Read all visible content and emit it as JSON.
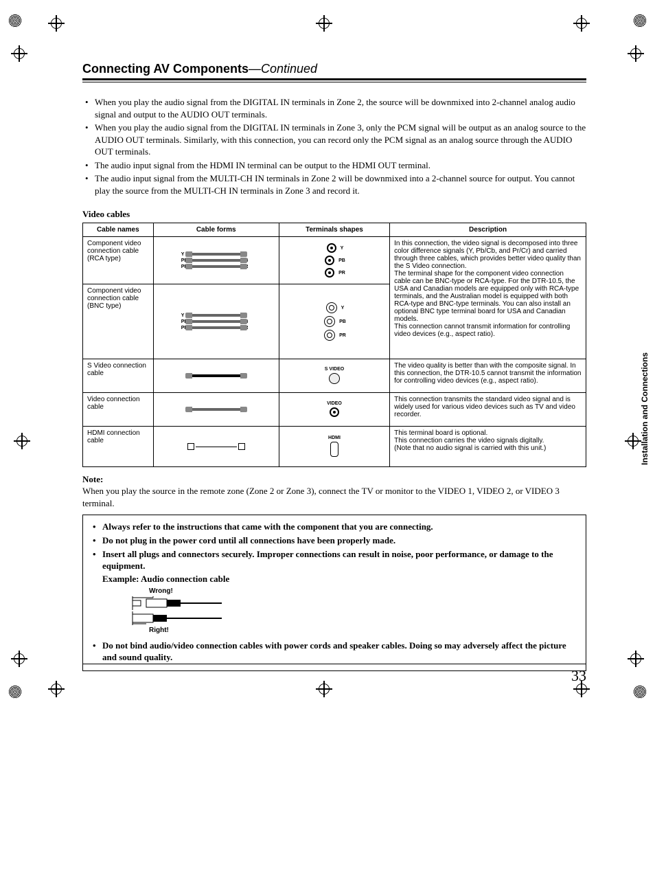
{
  "sideTab": "Installation and Connections",
  "pageNumber": "33",
  "heading": {
    "title": "Connecting AV Components",
    "suffix": "—Continued"
  },
  "bullets": [
    "When you play the audio signal from the DIGITAL IN terminals in Zone 2, the source will be downmixed into 2-channel analog audio signal and output to the AUDIO OUT terminals.",
    "When you play the audio signal from the DIGITAL IN terminals in Zone 3, only the PCM signal will be output as an analog source to the AUDIO OUT terminals. Similarly, with this connection, you can record only the PCM signal as an analog source through the AUDIO OUT terminals.",
    "The audio input signal from the HDMI IN terminal can be output to the HDMI OUT terminal.",
    "The audio input signal from the MULTI-CH IN terminals in Zone 2 will be downmixed into a 2-channel source for output. You cannot play the source from the MULTI-CH IN terminals in Zone 3 and record it."
  ],
  "videoCablesHeading": "Video cables",
  "table": {
    "headers": [
      "Cable names",
      "Cable forms",
      "Terminals shapes",
      "Description"
    ],
    "rows": [
      {
        "name": "Component video connection cable (RCA type)",
        "labels": [
          "Y",
          "PB",
          "PR"
        ],
        "termLabels": [
          "Y",
          "PB",
          "PR"
        ],
        "desc": "In this connection, the video signal is decomposed into three color difference signals (Y, Pb/Cb, and Pr/Cr) and carried through three cables, which provides better video quality than the S Video connection.\nThe terminal shape for the component video connection cable can be BNC-type or RCA-type. For the DTR-10.5, the USA and Canadian models are equipped only with RCA-type terminals, and the Australian model is equipped with both RCA-type and BNC-type terminals. You can also install an optional BNC type terminal board for USA and Canadian models.\nThis connection cannot transmit information for controlling video devices (e.g., aspect ratio).",
        "descRowspan": 2
      },
      {
        "name": "Component video connection cable (BNC type)",
        "labels": [
          "Y",
          "PB",
          "PR"
        ],
        "termLabels": [
          "Y",
          "PB",
          "PR"
        ]
      },
      {
        "name": "S Video connection cable",
        "termLabel": "S VIDEO",
        "desc": "The video quality is better than with the composite signal. In this connection, the DTR-10.5 cannot transmit the information for controlling video devices (e.g., aspect ratio)."
      },
      {
        "name": "Video connection cable",
        "termLabel": "VIDEO",
        "desc": "This connection transmits the standard video signal and is widely used for various video devices such as TV and video recorder."
      },
      {
        "name": "HDMI connection cable",
        "termLabel": "HDMI",
        "desc": "This terminal board is optional.\nThis connection carries the video signals digitally.\n(Note that no audio signal is carried with this unit.)"
      }
    ]
  },
  "noteLabel": "Note:",
  "noteText": "When you play the source in the remote zone (Zone 2 or Zone 3), connect the TV or monitor to the VIDEO 1, VIDEO 2, or VIDEO 3 terminal.",
  "warnings": {
    "items1": [
      "Always refer to the instructions that came with the component that you are connecting.",
      "Do not plug in the power cord until all connections have been properly made.",
      "Insert all plugs and connectors securely. Improper connections can result in noise, poor performance, or damage to the equipment."
    ],
    "exampleLine": "Example: Audio connection cable",
    "wrongLabel": "Wrong!",
    "rightLabel": "Right!",
    "items2": [
      "Do not bind audio/video connection cables with power cords and speaker cables. Doing so may adversely affect the picture and sound quality."
    ]
  }
}
